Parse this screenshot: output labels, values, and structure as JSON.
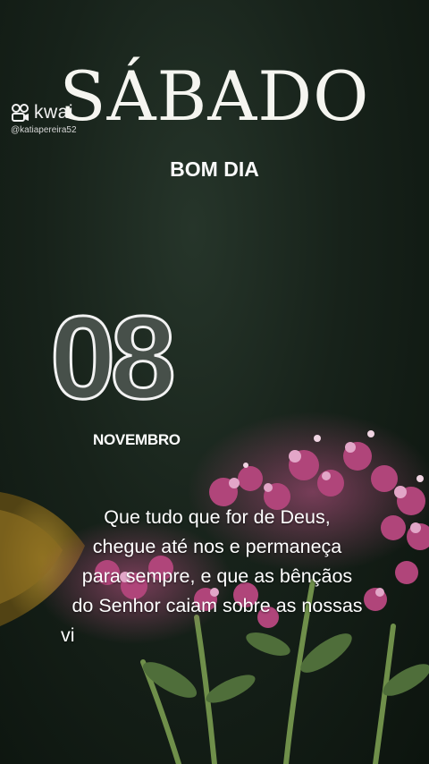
{
  "watermark": {
    "brand": "kwai",
    "username": "@katiapereira52"
  },
  "header": {
    "day": "SÁBADO",
    "greeting": "BOM DIA"
  },
  "date": {
    "day_number": "08",
    "month": "NOVEMBRO"
  },
  "message": {
    "lines": [
      "Que tudo que for de Deus,",
      "chegue até nos e permaneça",
      "para sempre, e que as bênçãos",
      "do Senhor caiam sobre as nossas",
      "vi"
    ]
  },
  "colors": {
    "background": "#17221a",
    "digit_fill": "#47504a",
    "blossom": "#b0457a",
    "text": "#ffffff"
  }
}
